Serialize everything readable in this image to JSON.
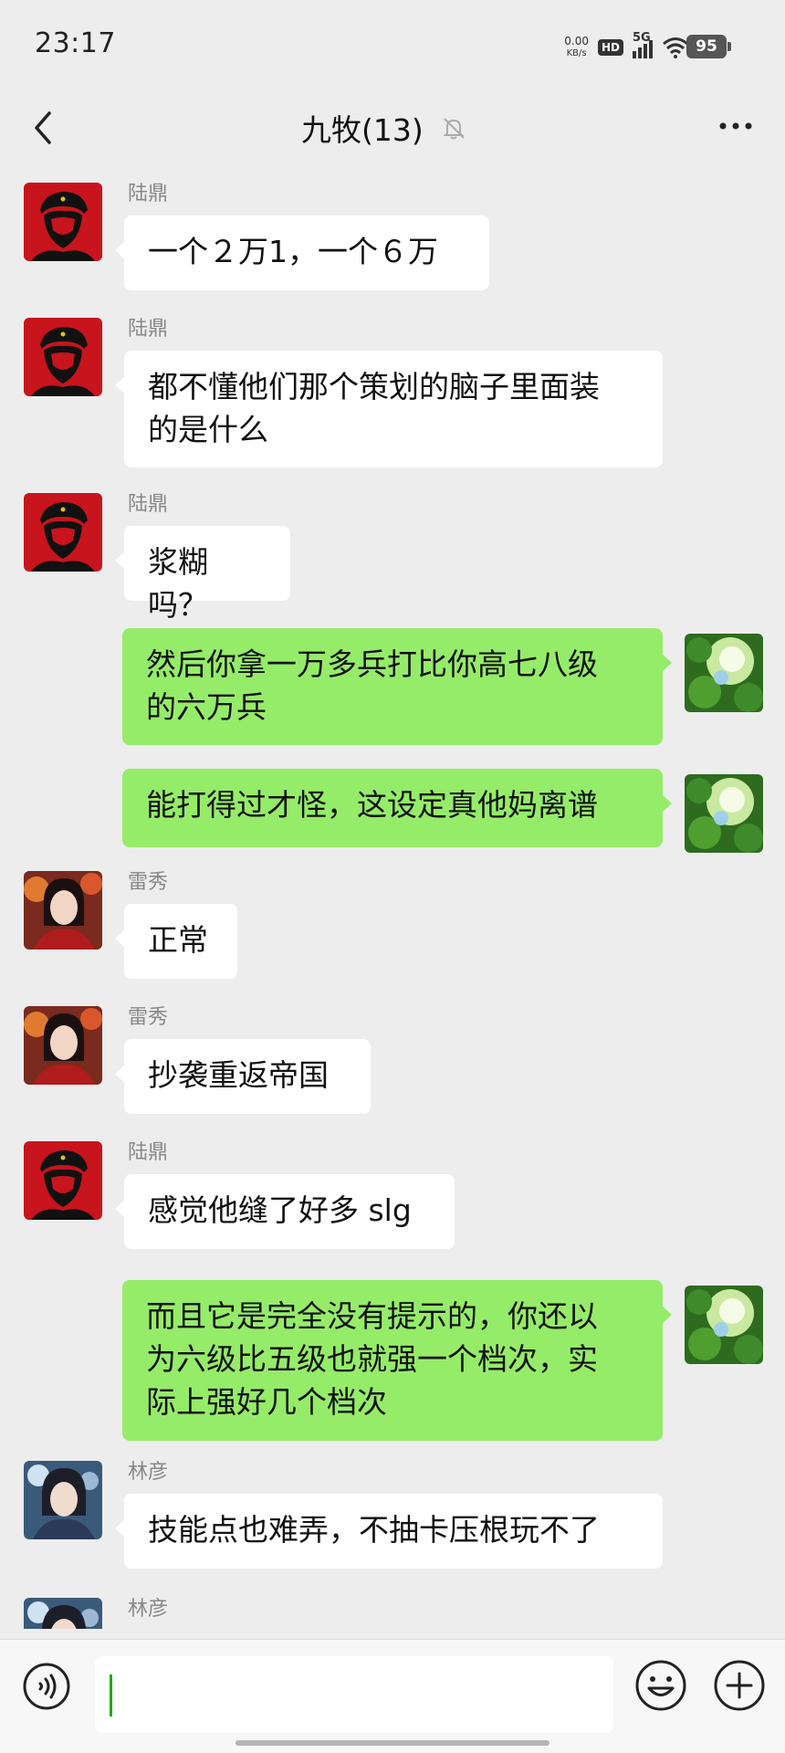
{
  "status_bar": {
    "time": "23:17",
    "net_speed_value": "0.00",
    "net_speed_unit": "KB/s",
    "hd_badge": "HD",
    "network": "5G",
    "battery": "95"
  },
  "header": {
    "title": "九牧(13)",
    "muted_icon": "bell-off-icon",
    "back_icon": "chevron-left-icon",
    "more_icon": "more-dots-icon"
  },
  "colors": {
    "background": "#ededed",
    "self_bubble": "#95ec69",
    "other_bubble": "#ffffff",
    "caret": "#1aad19"
  },
  "messages": [
    {
      "side": "left",
      "sender": "陆鼎",
      "avatar": "red-portrait-avatar",
      "lines": [
        "一个２万1，一个６万"
      ]
    },
    {
      "side": "left",
      "sender": "陆鼎",
      "avatar": "red-portrait-avatar",
      "lines": [
        "都不懂他们那个策划的脑子里面装",
        "的是什么"
      ]
    },
    {
      "side": "left",
      "sender": "陆鼎",
      "avatar": "red-portrait-avatar",
      "lines": [
        "浆糊吗？"
      ]
    },
    {
      "side": "right",
      "sender": "",
      "avatar": "green-leaves-avatar",
      "lines": [
        "然后你拿一万多兵打比你高七八级",
        "的六万兵"
      ]
    },
    {
      "side": "right",
      "sender": "",
      "avatar": "green-leaves-avatar",
      "lines": [
        "能打得过才怪，这设定真他妈离谱"
      ]
    },
    {
      "side": "left",
      "sender": "雷秀",
      "avatar": "anime-red-avatar",
      "lines": [
        "正常"
      ]
    },
    {
      "side": "left",
      "sender": "雷秀",
      "avatar": "anime-red-avatar",
      "lines": [
        "抄袭重返帝国"
      ]
    },
    {
      "side": "left",
      "sender": "陆鼎",
      "avatar": "red-portrait-avatar",
      "lines": [
        "感觉他缝了好多 slg"
      ]
    },
    {
      "side": "right",
      "sender": "",
      "avatar": "green-leaves-avatar",
      "lines": [
        "而且它是完全没有提示的，你还以",
        "为六级比五级也就强一个档次，实",
        "际上强好几个档次"
      ]
    },
    {
      "side": "left",
      "sender": "林彦",
      "avatar": "anime-blue-avatar",
      "lines": [
        "技能点也难弄，不抽卡压根玩不了"
      ]
    },
    {
      "side": "left",
      "sender": "林彦",
      "avatar": "anime-blue-avatar",
      "lines": [
        ""
      ]
    }
  ],
  "input_bar": {
    "voice_icon": "voice-icon",
    "emoji_icon": "emoji-icon",
    "plus_icon": "plus-icon",
    "value": ""
  }
}
